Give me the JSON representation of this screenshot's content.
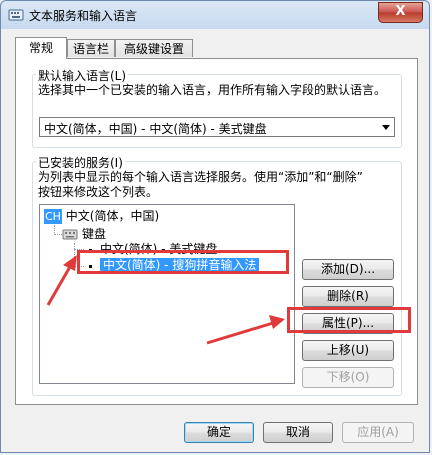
{
  "window": {
    "title": "文本服务和输入语言",
    "close_label": "X"
  },
  "tabs": [
    {
      "label": "常规",
      "active": true
    },
    {
      "label": "语言栏",
      "active": false
    },
    {
      "label": "高级键设置",
      "active": false
    }
  ],
  "default_language": {
    "group_label": "默认输入语言(L)",
    "description": "选择其中一个已安装的输入语言，用作所有输入字段的默认语言。",
    "selected_value": "中文(简体，中国) - 中文(简体) - 美式键盘"
  },
  "installed_services": {
    "group_label": "已安装的服务(I)",
    "description_line1": "为列表中显示的每个输入语言选择服务。使用“添加”和“删除”",
    "description_line2": "按钮来修改这个列表。",
    "tree": {
      "language_badge": "CH",
      "language": "中文(简体，中国)",
      "category": "键盘",
      "items": [
        {
          "label": "中文(简体) - 美式键盘",
          "selected": false
        },
        {
          "label": "中文(简体) - 搜狗拼音输入法",
          "selected": true
        }
      ]
    },
    "buttons": {
      "add": "添加(D)...",
      "remove": "删除(R)",
      "properties": "属性(P)...",
      "move_up": "上移(U)",
      "move_down": "下移(O)"
    }
  },
  "footer_buttons": {
    "ok": "确定",
    "cancel": "取消",
    "apply": "应用(A)"
  },
  "colors": {
    "highlight": "#e03a3a",
    "selection": "#3399ff"
  }
}
